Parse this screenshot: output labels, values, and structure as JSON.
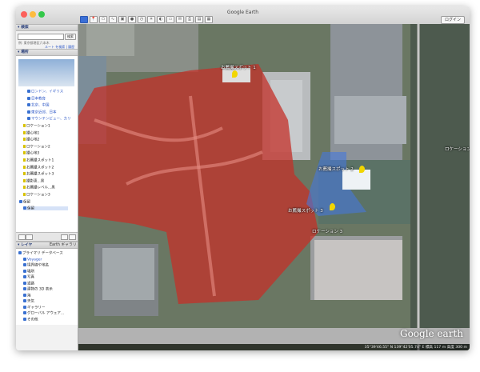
{
  "window": {
    "title": "Google Earth",
    "login_label": "ログイン"
  },
  "toolbar": {
    "icons": [
      "sidebar-toggle-icon",
      "placemark-icon",
      "polygon-icon",
      "path-icon",
      "overlay-icon",
      "tour-icon",
      "historical-imagery-icon",
      "sun-icon",
      "planets-icon",
      "ruler-icon",
      "email-icon",
      "print-icon",
      "save-image-icon",
      "view-in-maps-icon"
    ]
  },
  "sidebar": {
    "search": {
      "header": "検索",
      "button": "検索",
      "hint": "例: 東京都港区六本木",
      "links": [
        "ルート を検索",
        "履歴"
      ]
    },
    "places": {
      "header": "場所",
      "items": [
        {
          "label": "ロンドン、イギリス",
          "indent": 2,
          "kind": "check"
        },
        {
          "label": "日本教育",
          "indent": 2,
          "kind": "check"
        },
        {
          "label": "北京、中国",
          "indent": 2,
          "kind": "check"
        },
        {
          "label": "東京近郊、日本",
          "indent": 2,
          "kind": "check"
        },
        {
          "label": "マウンテンビュー、カリ",
          "indent": 2,
          "kind": "check"
        },
        {
          "label": "ロケーション1",
          "indent": 1,
          "kind": "pin"
        },
        {
          "label": "撮心地1",
          "indent": 1,
          "kind": "pin"
        },
        {
          "label": "撮心地2",
          "indent": 1,
          "kind": "pin"
        },
        {
          "label": "ロケーション2",
          "indent": 1,
          "kind": "pin"
        },
        {
          "label": "撮心地3",
          "indent": 1,
          "kind": "pin"
        },
        {
          "label": "お薦撮スポット1",
          "indent": 1,
          "kind": "pin"
        },
        {
          "label": "お薦撮スポット2",
          "indent": 1,
          "kind": "pin"
        },
        {
          "label": "お薦撮スポット3",
          "indent": 1,
          "kind": "pin"
        },
        {
          "label": "撮影恵...黒",
          "indent": 1,
          "kind": "pin"
        },
        {
          "label": "お薦撮レベル...黒",
          "indent": 1,
          "kind": "pin"
        },
        {
          "label": "ロケーション3",
          "indent": 1,
          "kind": "pin"
        },
        {
          "label": "保留",
          "indent": 0,
          "kind": "folder"
        },
        {
          "label": "保留",
          "indent": 1,
          "kind": "selected"
        }
      ]
    },
    "layers": {
      "header": "レイヤ",
      "gallery_label": "Earth ギャラリー",
      "items": [
        "プライマリ データベース",
        "Voyager",
        "境界線や地名",
        "場所",
        "写真",
        "道路",
        "建物の 3D 表示",
        "海",
        "天気",
        "ギャラリー",
        "グローバル アウェア...",
        "その他"
      ]
    }
  },
  "map": {
    "labels": {
      "spot1": "お薦撮スポット 1",
      "spot2": "お薦撮スポット 2",
      "spot3": "お薦撮スポット 3",
      "location_right": "ロケーション",
      "location3": "ロケーション 3"
    },
    "logo": "Google earth",
    "status": {
      "coords": "35°39'46.55\" N 139°42'05.74\" E",
      "elev": "標高 117 m",
      "eye": "高度 300 m"
    }
  }
}
